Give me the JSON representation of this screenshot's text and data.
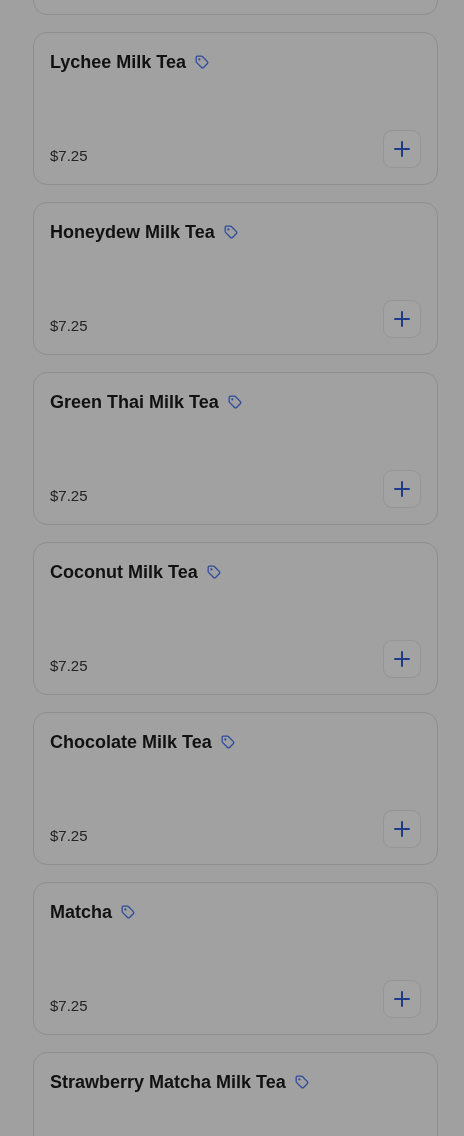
{
  "menu_items": [
    {
      "name": "Lychee Milk Tea",
      "price": "$7.25"
    },
    {
      "name": "Honeydew Milk Tea",
      "price": "$7.25"
    },
    {
      "name": "Green Thai Milk Tea",
      "price": "$7.25"
    },
    {
      "name": "Coconut Milk Tea",
      "price": "$7.25"
    },
    {
      "name": "Chocolate Milk Tea",
      "price": "$7.25"
    },
    {
      "name": "Matcha",
      "price": "$7.25"
    },
    {
      "name": "Strawberry Matcha Milk Tea"
    }
  ]
}
